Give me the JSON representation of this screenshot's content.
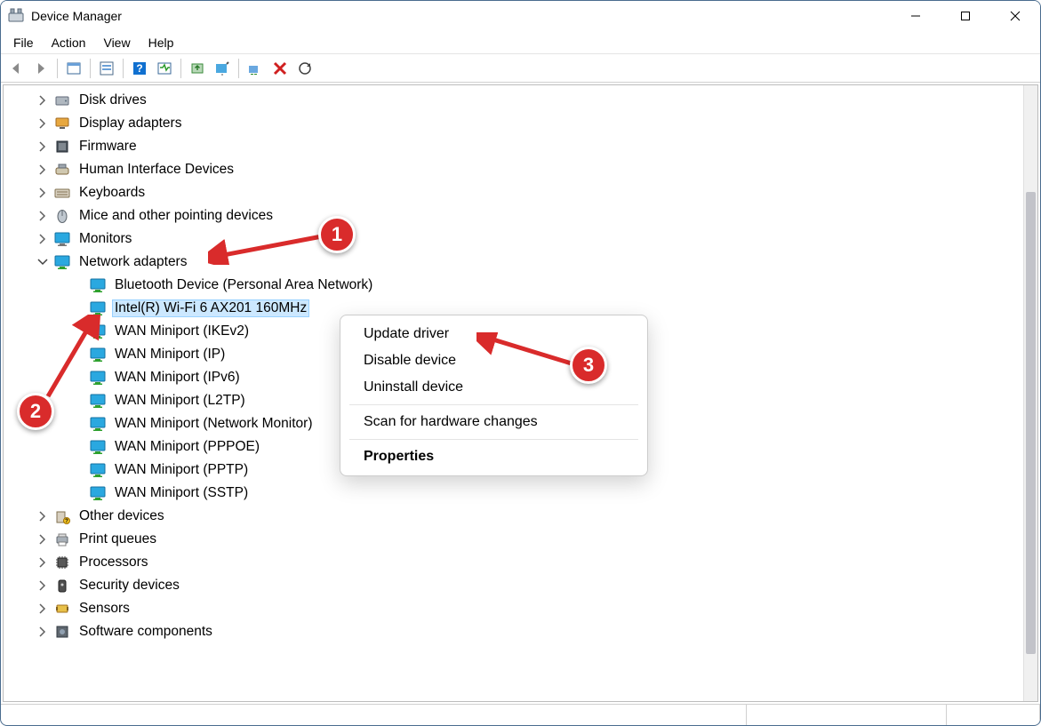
{
  "window": {
    "title": "Device Manager"
  },
  "menu": {
    "file": "File",
    "action": "Action",
    "view": "View",
    "help": "Help"
  },
  "tree": {
    "items": [
      {
        "label": "Disk drives",
        "icon": "disk",
        "expandable": true
      },
      {
        "label": "Display adapters",
        "icon": "display",
        "expandable": true
      },
      {
        "label": "Firmware",
        "icon": "firmware",
        "expandable": true
      },
      {
        "label": "Human Interface Devices",
        "icon": "hid",
        "expandable": true
      },
      {
        "label": "Keyboards",
        "icon": "keyboard",
        "expandable": true
      },
      {
        "label": "Mice and other pointing devices",
        "icon": "mouse",
        "expandable": true
      },
      {
        "label": "Monitors",
        "icon": "monitor",
        "expandable": true
      },
      {
        "label": "Network adapters",
        "icon": "network",
        "expandable": true,
        "expanded": true,
        "children": [
          {
            "label": "Bluetooth Device (Personal Area Network)"
          },
          {
            "label": "Intel(R) Wi-Fi 6 AX201 160MHz",
            "selected": true
          },
          {
            "label": "WAN Miniport (IKEv2)"
          },
          {
            "label": "WAN Miniport (IP)"
          },
          {
            "label": "WAN Miniport (IPv6)"
          },
          {
            "label": "WAN Miniport (L2TP)"
          },
          {
            "label": "WAN Miniport (Network Monitor)"
          },
          {
            "label": "WAN Miniport (PPPOE)"
          },
          {
            "label": "WAN Miniport (PPTP)"
          },
          {
            "label": "WAN Miniport (SSTP)"
          }
        ]
      },
      {
        "label": "Other devices",
        "icon": "other",
        "expandable": true
      },
      {
        "label": "Print queues",
        "icon": "printer",
        "expandable": true
      },
      {
        "label": "Processors",
        "icon": "cpu",
        "expandable": true
      },
      {
        "label": "Security devices",
        "icon": "security",
        "expandable": true
      },
      {
        "label": "Sensors",
        "icon": "sensor",
        "expandable": true
      },
      {
        "label": "Software components",
        "icon": "software",
        "expandable": true
      }
    ]
  },
  "ctx": {
    "update": "Update driver",
    "disable": "Disable device",
    "uninstall": "Uninstall device",
    "scan": "Scan for hardware changes",
    "props": "Properties"
  },
  "badges": {
    "b1": "1",
    "b2": "2",
    "b3": "3"
  }
}
